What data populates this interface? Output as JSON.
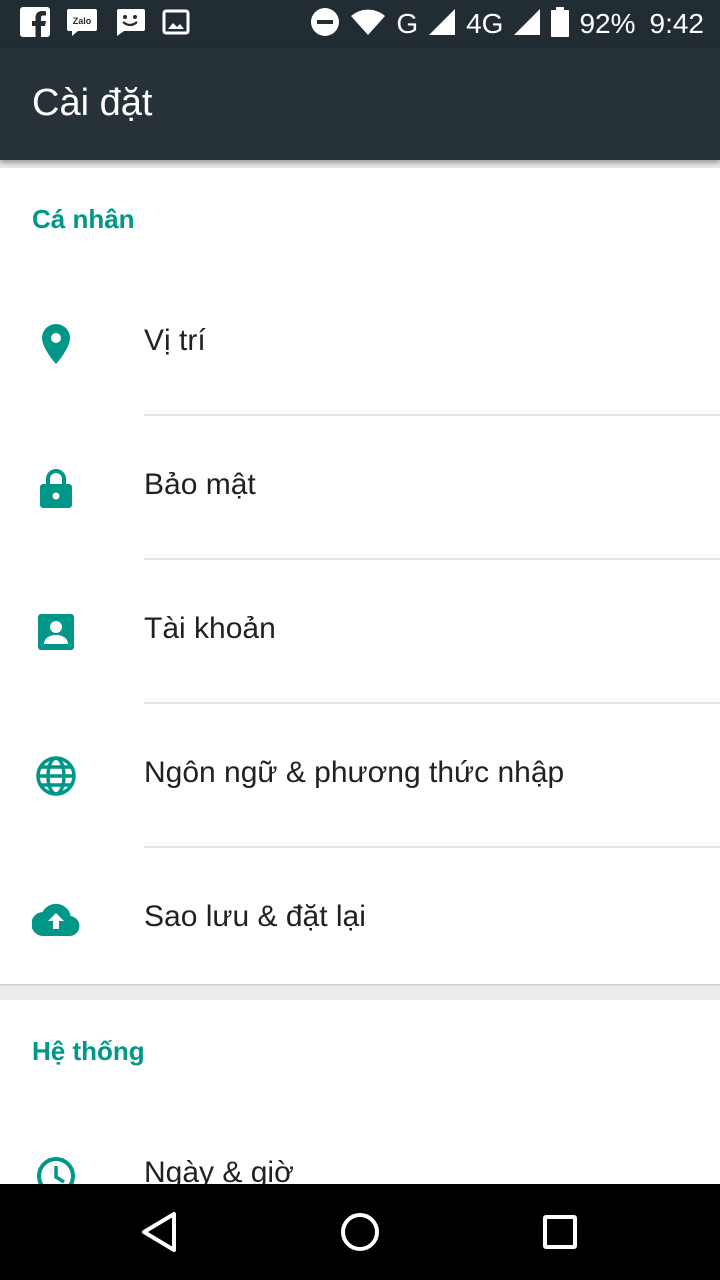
{
  "status_bar": {
    "left_icons": [
      "facebook-icon",
      "zalo-icon",
      "messaging-icon",
      "gallery-icon"
    ],
    "zalo_text": "Zalo",
    "network_g": "G",
    "network_4g": "4G",
    "battery": "92%",
    "battery_level": 0.92,
    "time": "9:42"
  },
  "appbar": {
    "title": "Cài đặt"
  },
  "sections": {
    "personal": {
      "header": "Cá nhân",
      "items": [
        {
          "label": "Vị trí",
          "icon": "location-pin-icon"
        },
        {
          "label": "Bảo mật",
          "icon": "lock-icon"
        },
        {
          "label": "Tài khoản",
          "icon": "account-box-icon"
        },
        {
          "label": "Ngôn ngữ & phương thức nhập",
          "icon": "globe-icon"
        },
        {
          "label": "Sao lưu & đặt lại",
          "icon": "cloud-upload-icon"
        }
      ]
    },
    "system": {
      "header": "Hệ thống",
      "items": [
        {
          "label": "Ngày & giờ",
          "icon": "clock-icon"
        }
      ]
    }
  },
  "nav": {
    "back": "back-icon",
    "home": "home-icon",
    "recents": "recents-icon"
  },
  "colors": {
    "accent": "#009688",
    "appbar": "#263238",
    "statusbar": "#222c33"
  }
}
